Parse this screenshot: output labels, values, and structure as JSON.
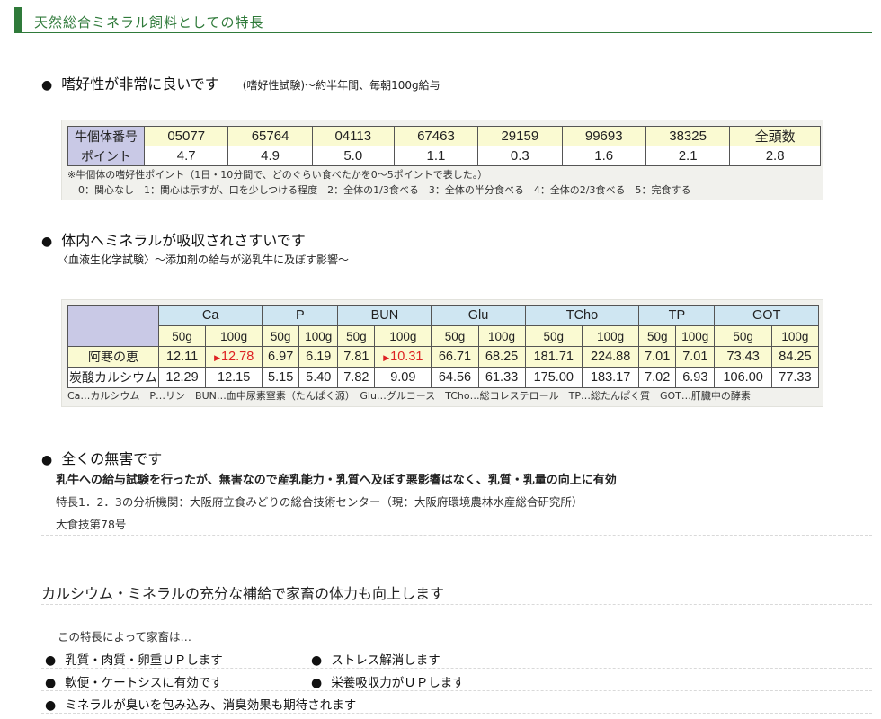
{
  "header": {
    "title": "天然総合ミネラル飼料としての特長"
  },
  "section1": {
    "heading": "嗜好性が非常に良いです",
    "note": "(嗜好性試験)～約半年間、毎朝100g給与",
    "table": {
      "row_labels": [
        "牛個体番号",
        "ポイント"
      ],
      "ids": [
        "05077",
        "65764",
        "04113",
        "67463",
        "29159",
        "99693",
        "38325",
        "全頭数"
      ],
      "points": [
        "4.7",
        "4.9",
        "5.0",
        "1.1",
        "0.3",
        "1.6",
        "2.1",
        "2.8"
      ]
    },
    "footnote1": "※牛個体の嗜好性ポイント（1日・10分間で、どのぐらい食べたかを0～5ポイントで表した。）",
    "footnote2": "0：関心なし　1：関心は示すが、口を少しつける程度　2：全体の1/3食べる　3：全体の半分食べる　4：全体の2/3食べる　5：完食する"
  },
  "section2": {
    "heading": "体内へミネラルが吸収されさすいです",
    "sub": "〈血液生化学試験〉～添加剤の給与が泌乳牛に及ぼす影響～",
    "table": {
      "groups": [
        "Ca",
        "P",
        "BUN",
        "Glu",
        "TCho",
        "TP",
        "GOT"
      ],
      "doses": [
        "50g",
        "100g"
      ],
      "rows": [
        {
          "label": "阿寒の恵",
          "values": [
            "12.11",
            "12.78",
            "6.97",
            "6.19",
            "7.81",
            "10.31",
            "66.71",
            "68.25",
            "181.71",
            "224.88",
            "7.01",
            "7.01",
            "73.43",
            "84.25"
          ]
        },
        {
          "label": "炭酸カルシウム",
          "values": [
            "12.29",
            "12.15",
            "5.15",
            "5.40",
            "7.82",
            "9.09",
            "64.56",
            "61.33",
            "175.00",
            "183.17",
            "7.02",
            "6.93",
            "106.00",
            "77.33"
          ]
        }
      ]
    },
    "legend": "Ca…カルシウム　P…リン　BUN…血中尿素窒素（たんぱく源）　Glu…グルコース　TCho…総コレステロール　TP…総たんぱく質　GOT…肝臓中の酵素"
  },
  "section3": {
    "heading": "全くの無害です",
    "bold_line": "乳牛への給与試験を行ったが、無害なので産乳能力・乳質へ及ぼす悪影響はなく、乳質・乳量の向上に有効",
    "line2": "特長1．2．3の分析機関：大阪府立食みどりの総合技術センター（現：大阪府環境農林水産総合研究所）",
    "line3": "大食技第78号"
  },
  "section4": {
    "heading": "カルシウム・ミネラルの充分な補給で家畜の体力も向上します",
    "intro": "この特長によって家畜は…",
    "features": [
      "乳質・肉質・卵重ＵＰします",
      "ストレス解消します",
      "軟便・ケートシスに有効です",
      "栄養吸収力がＵＰします",
      "ミネラルが臭いを包み込み、消臭効果も期待されます"
    ]
  },
  "colors": {
    "accent": "#2f7a3a",
    "label_bg": "#c9c9e6",
    "yellow_bg": "#fafad2",
    "blue_bg": "#cfe6f2",
    "highlight": "#dd2222"
  }
}
